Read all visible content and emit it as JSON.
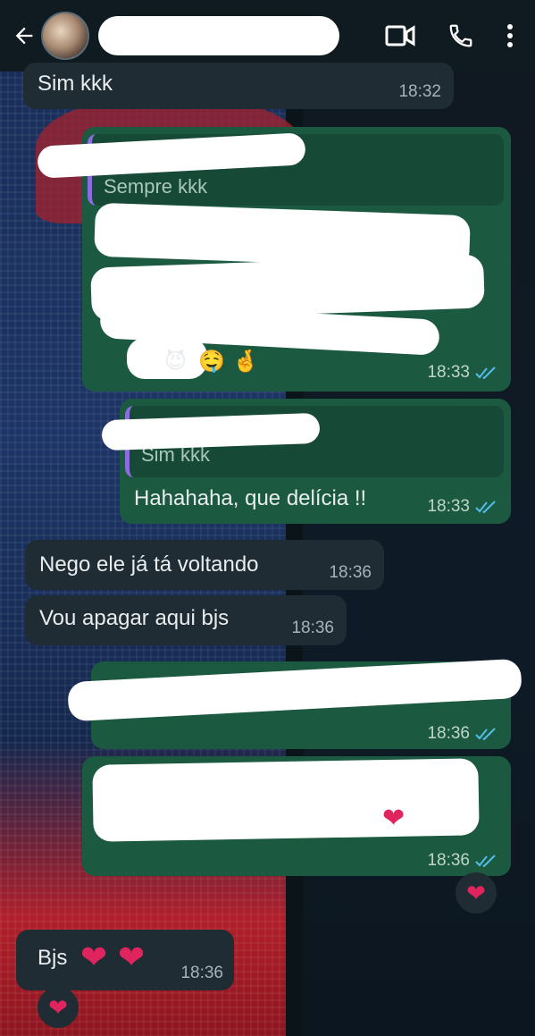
{
  "header": {
    "back_icon": "arrow-left-icon",
    "contact_name": "",
    "icons": [
      "video-call-icon",
      "phone-icon",
      "more-vert-icon"
    ]
  },
  "messages": {
    "m1": {
      "text": "Sim kkk",
      "time": "18:32"
    },
    "m2": {
      "quote": "Sempre kkk",
      "time": "18:33"
    },
    "m3": {
      "quote": "Sim kkk",
      "text": "Hahahaha, que delícia !!",
      "time": "18:33"
    },
    "m4": {
      "text": "Nego ele já tá voltando",
      "time": "18:36"
    },
    "m5": {
      "text": "Vou apagar aqui bjs",
      "time": "18:36"
    },
    "m6": {
      "time": "18:36"
    },
    "m7": {
      "time": "18:36",
      "reaction": "red-heart"
    },
    "m8": {
      "text": "Bjs",
      "time": "18:36",
      "reaction": "red-heart"
    }
  },
  "colors": {
    "incoming": "#1f2c33",
    "outgoing": "#1b5a41",
    "read_ticks": "#53bdeb",
    "quote_bar": "#8b6ddf"
  }
}
